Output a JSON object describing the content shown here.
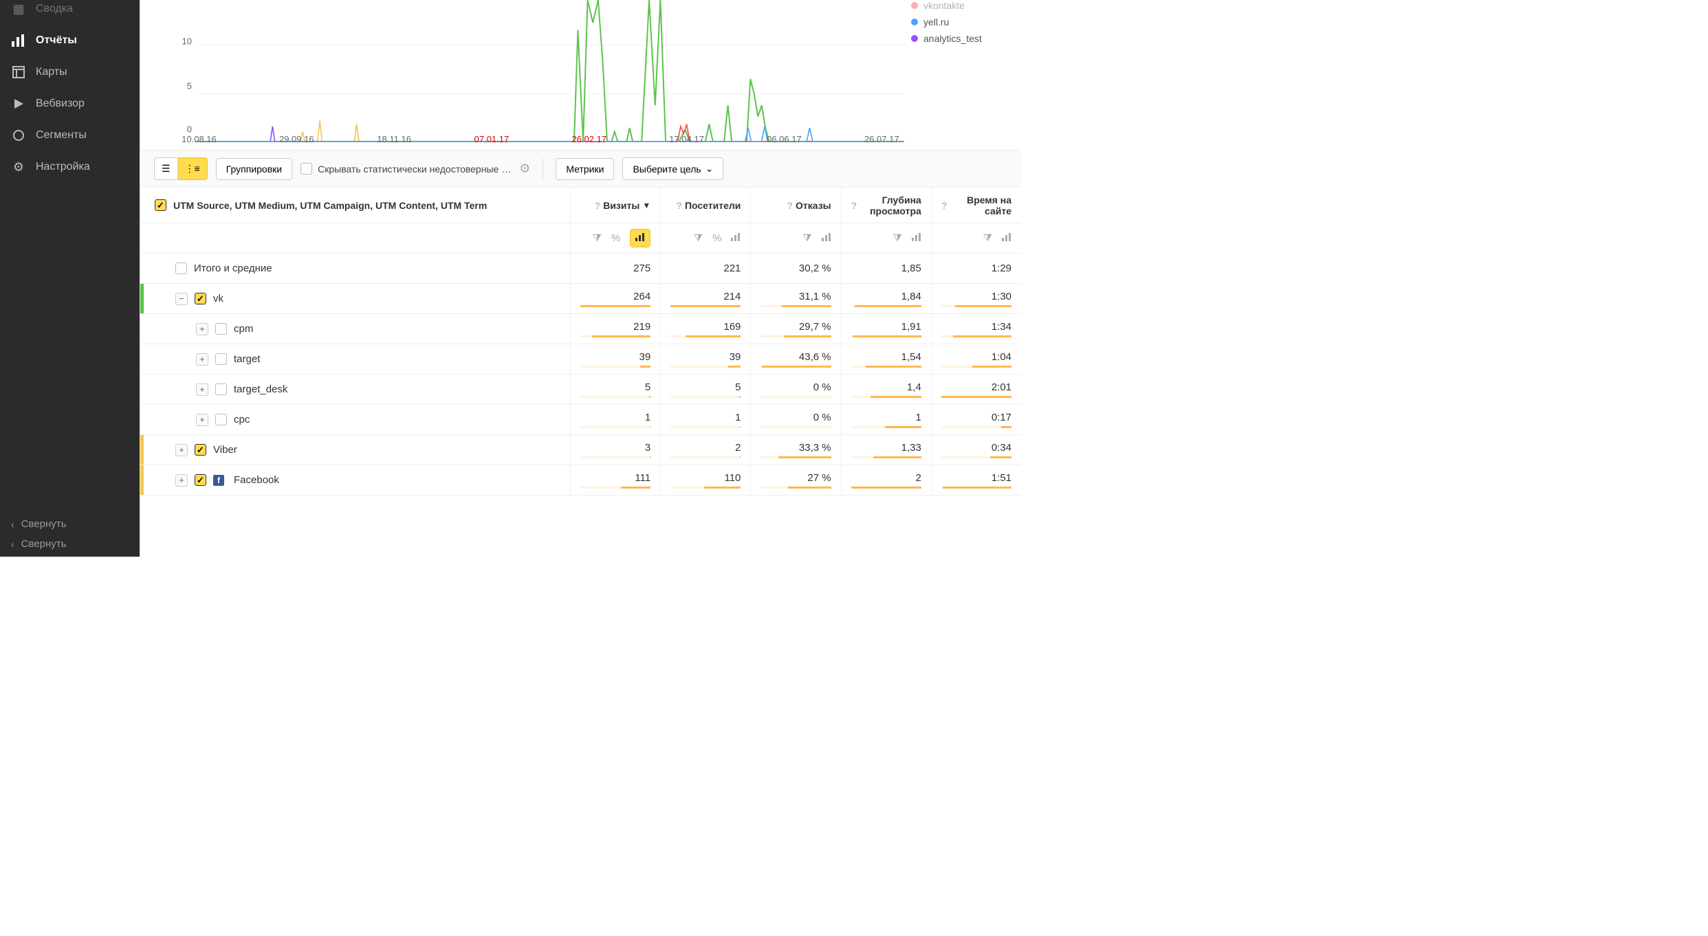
{
  "sidebar": {
    "items": [
      {
        "label": "Сводка",
        "icon": "dashboard"
      },
      {
        "label": "Отчёты",
        "icon": "bar-chart",
        "active": true
      },
      {
        "label": "Карты",
        "icon": "layout"
      },
      {
        "label": "Вебвизор",
        "icon": "play"
      },
      {
        "label": "Сегменты",
        "icon": "circle"
      },
      {
        "label": "Настройка",
        "icon": "gear"
      }
    ],
    "collapse": "Свернуть",
    "collapse2": "Свернуть"
  },
  "chart_data": {
    "type": "line",
    "y_ticks": [
      0,
      5,
      10
    ],
    "ylim": [
      0,
      15
    ],
    "x_ticks": [
      {
        "label": "10.08.16",
        "pos": 0.0
      },
      {
        "label": "29.09.16",
        "pos": 0.14
      },
      {
        "label": "18.11.16",
        "pos": 0.28
      },
      {
        "label": "07.01.17",
        "pos": 0.42,
        "red": true
      },
      {
        "label": "26.02.17",
        "pos": 0.56,
        "red": true
      },
      {
        "label": "17.04.17",
        "pos": 0.7
      },
      {
        "label": "06.06.17",
        "pos": 0.84
      },
      {
        "label": "26.07.17",
        "pos": 0.98
      }
    ],
    "series": [
      {
        "name": "vkontakte",
        "color": "#ff4d4d"
      },
      {
        "name": "yell.ru",
        "color": "#4aa3ff"
      },
      {
        "name": "analytics_test",
        "color": "#9b4dff"
      }
    ],
    "extra_series_green": "#5bc24b",
    "extra_series_yellow": "#f2c94c"
  },
  "toolbar": {
    "groupings": "Группировки",
    "hide_stat": "Скрывать статистически недостоверные …",
    "metrics": "Метрики",
    "goal_select": "Выберите цель"
  },
  "table": {
    "dimension_header": "UTM Source, UTM Medium, UTM Campaign, UTM Content, UTM Term",
    "columns": [
      {
        "key": "visits",
        "label": "Визиты",
        "sort": true,
        "icons": [
          "filter",
          "%",
          "chart"
        ]
      },
      {
        "key": "users",
        "label": "Посетители",
        "icons": [
          "filter",
          "%",
          "chart"
        ]
      },
      {
        "key": "bounce",
        "label": "Отказы",
        "icons": [
          "filter",
          "chart"
        ]
      },
      {
        "key": "depth",
        "label": "Глубина просмотра",
        "icons": [
          "filter",
          "chart"
        ]
      },
      {
        "key": "time",
        "label": "Время на сайте",
        "icons": [
          "filter",
          "chart"
        ]
      }
    ],
    "totals_label": "Итого и средние",
    "totals": {
      "visits": "275",
      "users": "221",
      "bounce": "30,2 %",
      "depth": "1,85",
      "time": "1:29"
    },
    "rows": [
      {
        "label": "vk",
        "level": 1,
        "checked": true,
        "expanded": true,
        "bar_color": "#5bc24b",
        "visits": "264",
        "users": "214",
        "bounce": "31,1 %",
        "depth": "1,84",
        "time": "1:30",
        "w": {
          "visits": 100,
          "users": 100,
          "bounce": 70,
          "depth": 95,
          "time": 80
        }
      },
      {
        "label": "cpm",
        "level": 2,
        "checked": false,
        "expanded": false,
        "visits": "219",
        "users": "169",
        "bounce": "29,7 %",
        "depth": "1,91",
        "time": "1:34",
        "w": {
          "visits": 83,
          "users": 79,
          "bounce": 67,
          "depth": 98,
          "time": 83
        }
      },
      {
        "label": "target",
        "level": 2,
        "checked": false,
        "expanded": false,
        "visits": "39",
        "users": "39",
        "bounce": "43,6 %",
        "depth": "1,54",
        "time": "1:04",
        "w": {
          "visits": 15,
          "users": 18,
          "bounce": 98,
          "depth": 79,
          "time": 56
        }
      },
      {
        "label": "target_desk",
        "level": 2,
        "checked": false,
        "expanded": false,
        "visits": "5",
        "users": "5",
        "bounce": "0 %",
        "depth": "1,4",
        "time": "2:01",
        "w": {
          "visits": 2,
          "users": 2,
          "bounce": 0,
          "depth": 72,
          "time": 100
        }
      },
      {
        "label": "cpc",
        "level": 2,
        "checked": false,
        "expanded": false,
        "visits": "1",
        "users": "1",
        "bounce": "0 %",
        "depth": "1",
        "time": "0:17",
        "w": {
          "visits": 1,
          "users": 1,
          "bounce": 0,
          "depth": 52,
          "time": 15
        }
      },
      {
        "label": "Viber",
        "level": 1,
        "checked": true,
        "expanded": false,
        "bar_color": "#f2c94c",
        "visits": "3",
        "users": "2",
        "bounce": "33,3 %",
        "depth": "1,33",
        "time": "0:34",
        "w": {
          "visits": 1,
          "users": 1,
          "bounce": 75,
          "depth": 68,
          "time": 30
        }
      },
      {
        "label": "Facebook",
        "level": 1,
        "checked": true,
        "expanded": false,
        "bar_color": "#f2c94c",
        "fb": true,
        "visits": "111",
        "users": "110",
        "bounce": "27 %",
        "depth": "2",
        "time": "1:51",
        "w": {
          "visits": 42,
          "users": 52,
          "bounce": 61,
          "depth": 100,
          "time": 98
        }
      }
    ]
  }
}
